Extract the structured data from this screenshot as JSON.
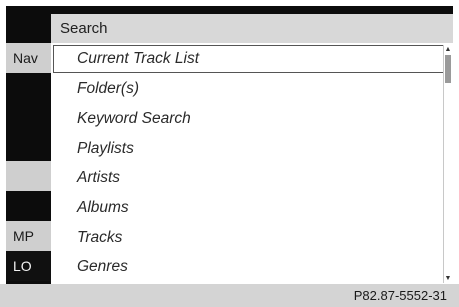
{
  "menu": {
    "title": "Search",
    "items": [
      {
        "label": "Current Track List",
        "selected": true
      },
      {
        "label": "Folder(s)"
      },
      {
        "label": "Keyword Search"
      },
      {
        "label": "Playlists"
      },
      {
        "label": "Artists"
      },
      {
        "label": "Albums"
      },
      {
        "label": "Tracks"
      },
      {
        "label": "Genres"
      }
    ]
  },
  "background": {
    "strip1": "Nav",
    "strip2": "MP",
    "strip3": "LO"
  },
  "scrollbar": {
    "up_icon": "▲",
    "down_icon": "▼"
  },
  "footer": {
    "ref": "P82.87-5552-31"
  },
  "colors": {
    "screen_bg": "#0c0c0c",
    "menu_header": "#d8d8d8",
    "list_bg": "#ffffff",
    "strip_light": "#cfcfcf"
  }
}
